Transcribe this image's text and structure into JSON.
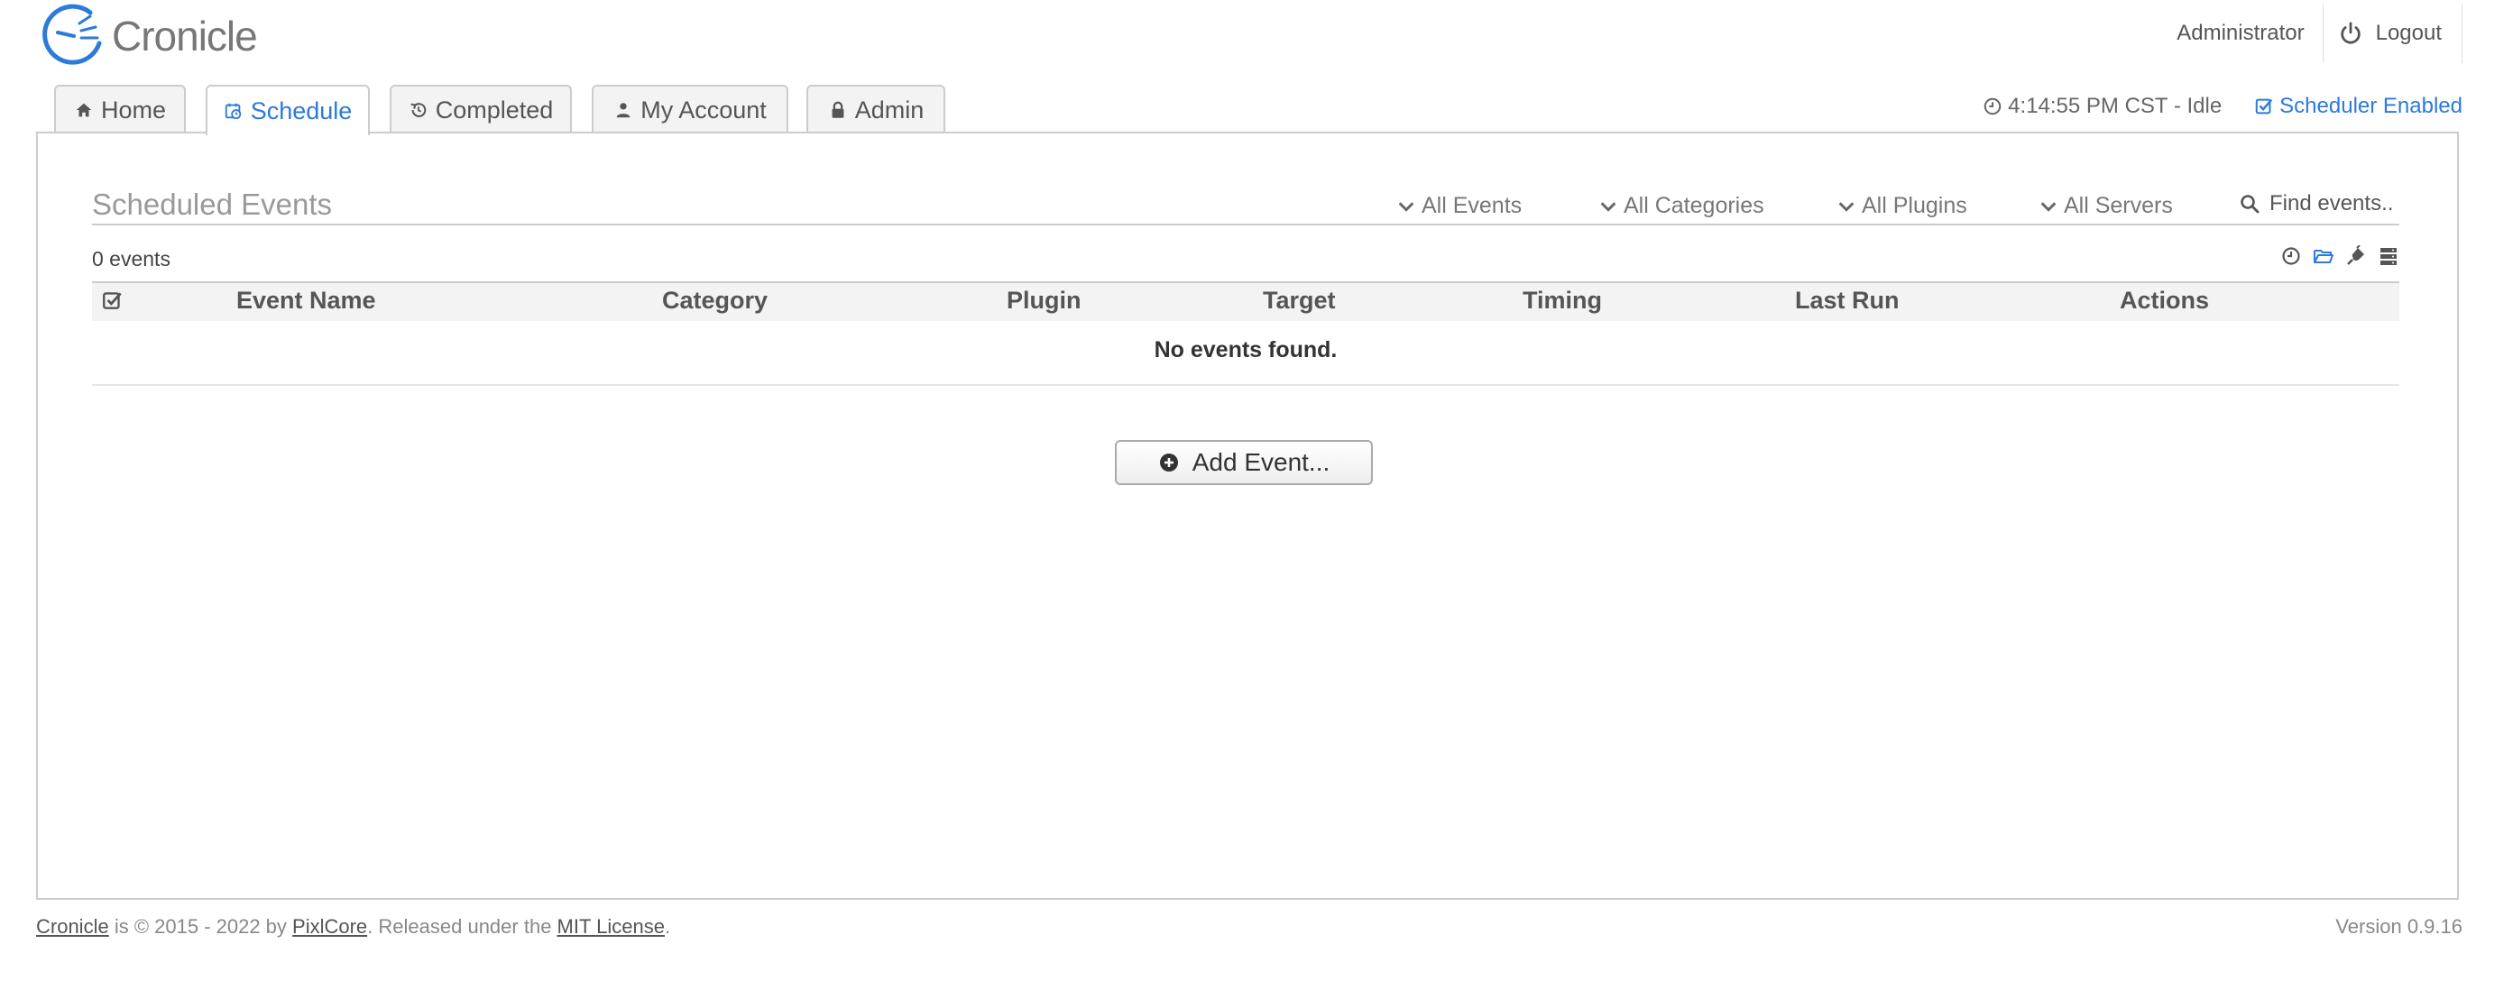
{
  "brand": {
    "name": "Cronicle"
  },
  "user": {
    "name": "Administrator",
    "logout_label": "Logout"
  },
  "tabs": [
    {
      "label": "Home",
      "icon": "home-icon"
    },
    {
      "label": "Schedule",
      "icon": "calendar-icon",
      "active": true
    },
    {
      "label": "Completed",
      "icon": "history-icon"
    },
    {
      "label": "My Account",
      "icon": "user-icon"
    },
    {
      "label": "Admin",
      "icon": "lock-icon"
    }
  ],
  "status": {
    "clock_text": "4:14:55 PM CST - Idle",
    "scheduler_label": "Scheduler Enabled"
  },
  "section": {
    "title": "Scheduled Events",
    "count_text": "0 events",
    "filters": {
      "events": "All Events",
      "categories": "All Categories",
      "plugins": "All Plugins",
      "servers": "All Servers"
    },
    "search_placeholder": "Find events..",
    "view_icons": [
      "clock-icon",
      "folder-icon",
      "plug-icon",
      "server-icon"
    ]
  },
  "table": {
    "headers": [
      "Event Name",
      "Category",
      "Plugin",
      "Target",
      "Timing",
      "Last Run",
      "Actions"
    ],
    "empty_text": "No events found."
  },
  "add_button_label": "Add Event...",
  "footer": {
    "brand_link": "Cronicle",
    "text1": " is © 2015 - 2022 by ",
    "company_link": "PixlCore",
    "text2": ". Released under the ",
    "license_link": "MIT License",
    "text3": ".",
    "version": "Version 0.9.16"
  },
  "colors": {
    "accent": "#2c7ad9",
    "text": "#555555",
    "border": "#cccccc"
  }
}
